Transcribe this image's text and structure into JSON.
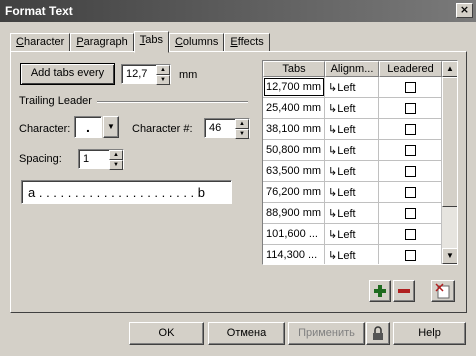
{
  "window": {
    "title": "Format Text",
    "close_glyph": "×"
  },
  "tabs": [
    "Character",
    "Paragraph",
    "Tabs",
    "Columns",
    "Effects"
  ],
  "add_tabs": {
    "button_label": "Add tabs every",
    "value": "12,7",
    "unit": "mm"
  },
  "trailing_leader": {
    "section_label": "Trailing Leader",
    "character_label": "Character:",
    "character_value": ".",
    "character_num_label": "Character #:",
    "character_num_value": "46",
    "spacing_label": "Spacing:",
    "spacing_value": "1",
    "preview_text": "a . . . . . . . . . . . . . . . . . . . . . . b"
  },
  "tab_table": {
    "columns": [
      "Tabs",
      "Alignm...",
      "Leadered"
    ],
    "rows": [
      {
        "tab": "12,700 mm",
        "alignment": "Left",
        "leadered": false
      },
      {
        "tab": "25,400 mm",
        "alignment": "Left",
        "leadered": false
      },
      {
        "tab": "38,100 mm",
        "alignment": "Left",
        "leadered": false
      },
      {
        "tab": "50,800 mm",
        "alignment": "Left",
        "leadered": false
      },
      {
        "tab": "63,500 mm",
        "alignment": "Left",
        "leadered": false
      },
      {
        "tab": "76,200 mm",
        "alignment": "Left",
        "leadered": false
      },
      {
        "tab": "88,900 mm",
        "alignment": "Left",
        "leadered": false
      },
      {
        "tab": "101,600 ...",
        "alignment": "Left",
        "leadered": false
      },
      {
        "tab": "114,300 ...",
        "alignment": "Left",
        "leadered": false
      }
    ],
    "align_glyph": "↳"
  },
  "footer": {
    "ok": "OK",
    "cancel": "Отмена",
    "apply": "Применить",
    "help": "Help"
  },
  "icons": {
    "add": "plus-icon",
    "remove": "minus-icon",
    "delete_all": "clear-tabs-icon",
    "lock": "lock-icon"
  },
  "colors": {
    "dialog_bg": "#d4d0c8",
    "plus": "#1f6b1f",
    "minus": "#b02020"
  }
}
